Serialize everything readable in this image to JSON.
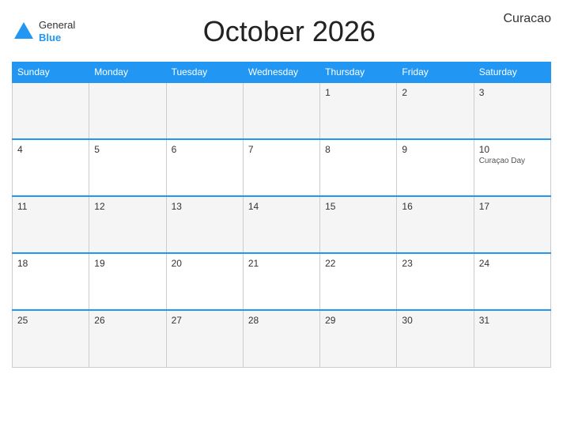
{
  "header": {
    "logo_general": "General",
    "logo_blue": "Blue",
    "title": "October 2026",
    "country": "Curacao"
  },
  "days_of_week": [
    "Sunday",
    "Monday",
    "Tuesday",
    "Wednesday",
    "Thursday",
    "Friday",
    "Saturday"
  ],
  "weeks": [
    [
      {
        "day": "",
        "holiday": ""
      },
      {
        "day": "",
        "holiday": ""
      },
      {
        "day": "",
        "holiday": ""
      },
      {
        "day": "",
        "holiday": ""
      },
      {
        "day": "1",
        "holiday": ""
      },
      {
        "day": "2",
        "holiday": ""
      },
      {
        "day": "3",
        "holiday": ""
      }
    ],
    [
      {
        "day": "4",
        "holiday": ""
      },
      {
        "day": "5",
        "holiday": ""
      },
      {
        "day": "6",
        "holiday": ""
      },
      {
        "day": "7",
        "holiday": ""
      },
      {
        "day": "8",
        "holiday": ""
      },
      {
        "day": "9",
        "holiday": ""
      },
      {
        "day": "10",
        "holiday": "Curaçao Day"
      }
    ],
    [
      {
        "day": "11",
        "holiday": ""
      },
      {
        "day": "12",
        "holiday": ""
      },
      {
        "day": "13",
        "holiday": ""
      },
      {
        "day": "14",
        "holiday": ""
      },
      {
        "day": "15",
        "holiday": ""
      },
      {
        "day": "16",
        "holiday": ""
      },
      {
        "day": "17",
        "holiday": ""
      }
    ],
    [
      {
        "day": "18",
        "holiday": ""
      },
      {
        "day": "19",
        "holiday": ""
      },
      {
        "day": "20",
        "holiday": ""
      },
      {
        "day": "21",
        "holiday": ""
      },
      {
        "day": "22",
        "holiday": ""
      },
      {
        "day": "23",
        "holiday": ""
      },
      {
        "day": "24",
        "holiday": ""
      }
    ],
    [
      {
        "day": "25",
        "holiday": ""
      },
      {
        "day": "26",
        "holiday": ""
      },
      {
        "day": "27",
        "holiday": ""
      },
      {
        "day": "28",
        "holiday": ""
      },
      {
        "day": "29",
        "holiday": ""
      },
      {
        "day": "30",
        "holiday": ""
      },
      {
        "day": "31",
        "holiday": ""
      }
    ]
  ]
}
